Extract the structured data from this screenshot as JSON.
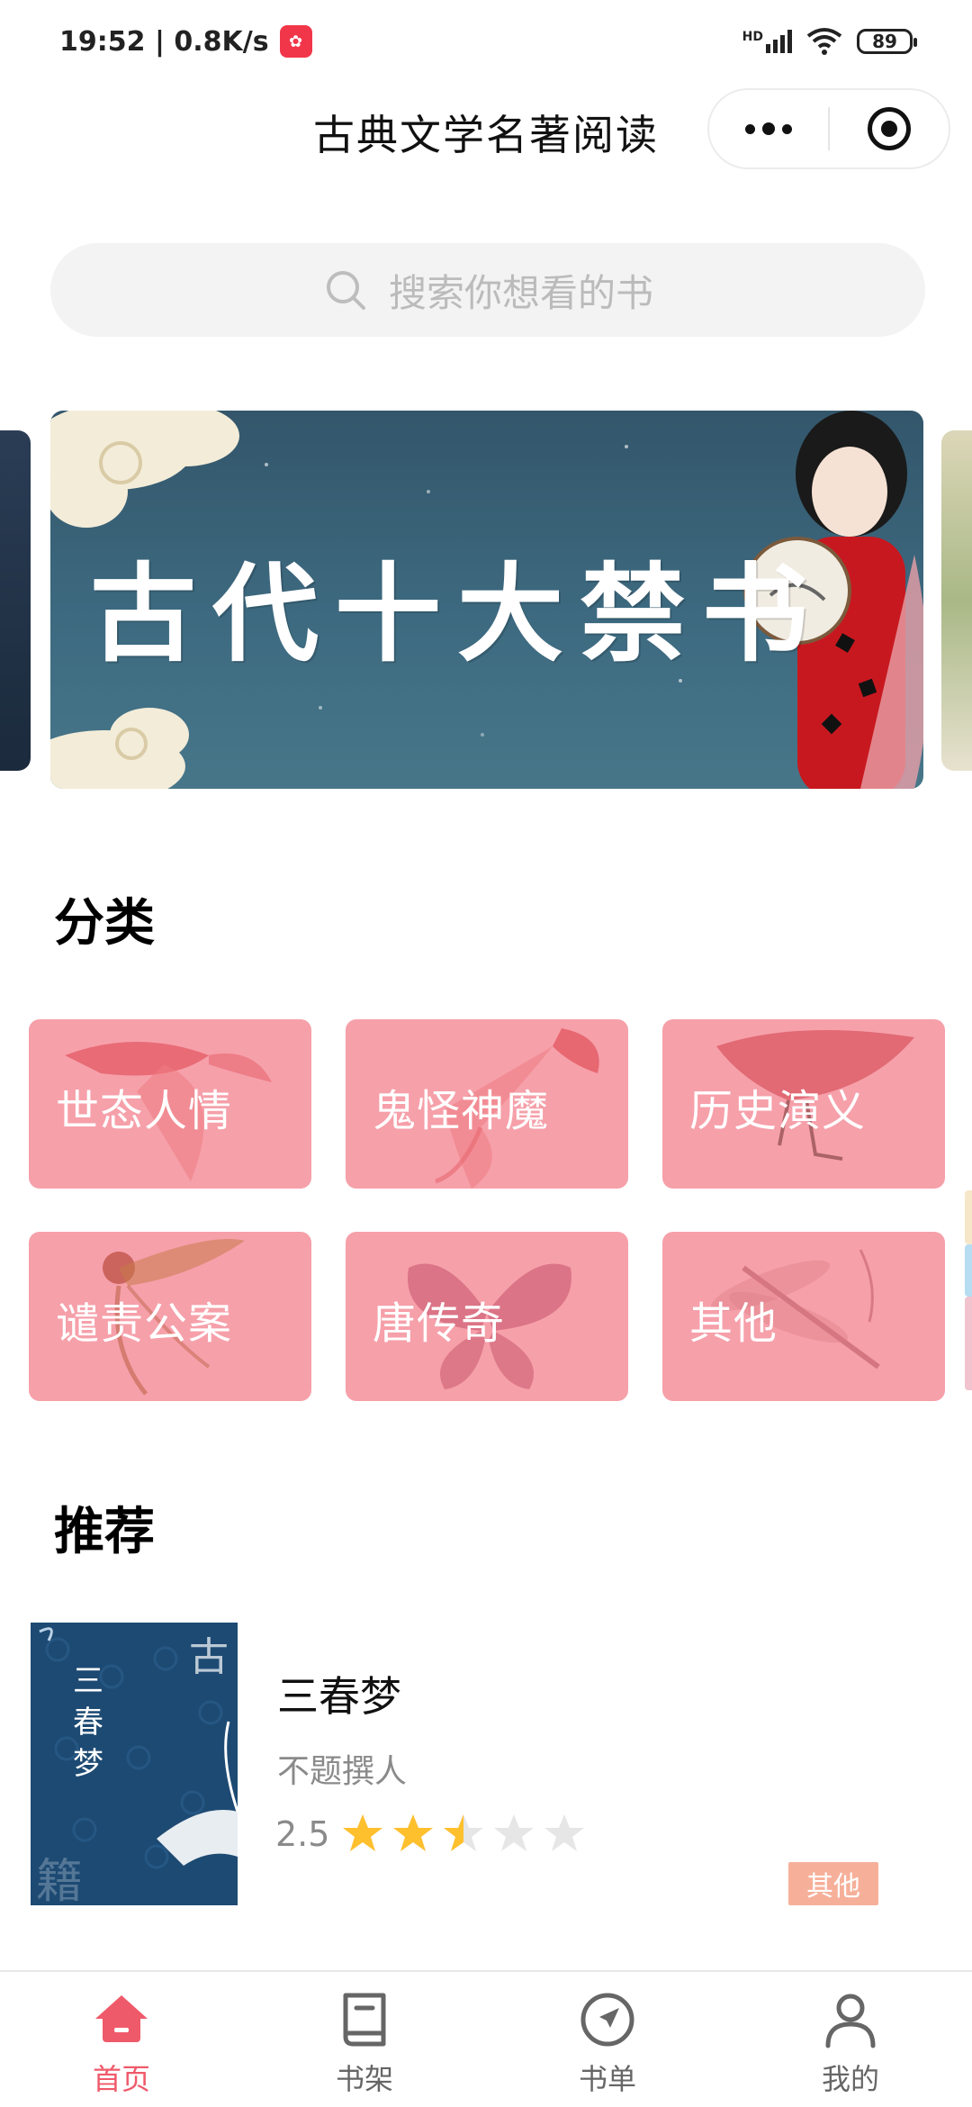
{
  "status_bar": {
    "time_speed": "19:52 | 0.8K/s",
    "network": "HD",
    "battery": "89"
  },
  "header": {
    "title": "古典文学名著阅读"
  },
  "search": {
    "placeholder": "搜索你想看的书"
  },
  "banner": {
    "text": "古代十大禁书"
  },
  "categories": {
    "title": "分类",
    "items": [
      {
        "label": "世态人情"
      },
      {
        "label": "鬼怪神魔"
      },
      {
        "label": "历史演义"
      },
      {
        "label": "谴责公案"
      },
      {
        "label": "唐传奇"
      },
      {
        "label": "其他"
      }
    ]
  },
  "recommend": {
    "title": "推荐",
    "book": {
      "title": "三春梦",
      "cover_title": "三春梦",
      "cover_corner": "古",
      "cover_corner2": "籍",
      "author": "不题撰人",
      "rating": "2.5",
      "rating_value": 2.5,
      "rating_max": 5,
      "tag": "其他"
    }
  },
  "tabbar": {
    "items": [
      {
        "label": "首页",
        "icon": "home-icon",
        "active": true
      },
      {
        "label": "书架",
        "icon": "book-icon",
        "active": false
      },
      {
        "label": "书单",
        "icon": "compass-icon",
        "active": false
      },
      {
        "label": "我的",
        "icon": "user-icon",
        "active": false
      }
    ]
  },
  "colors": {
    "accent": "#ef5a6a",
    "category_card": "#f6a0aa",
    "star_on": "#ffc02e",
    "star_off": "#e6e6e6",
    "tag_bg": "#f6b09a"
  }
}
